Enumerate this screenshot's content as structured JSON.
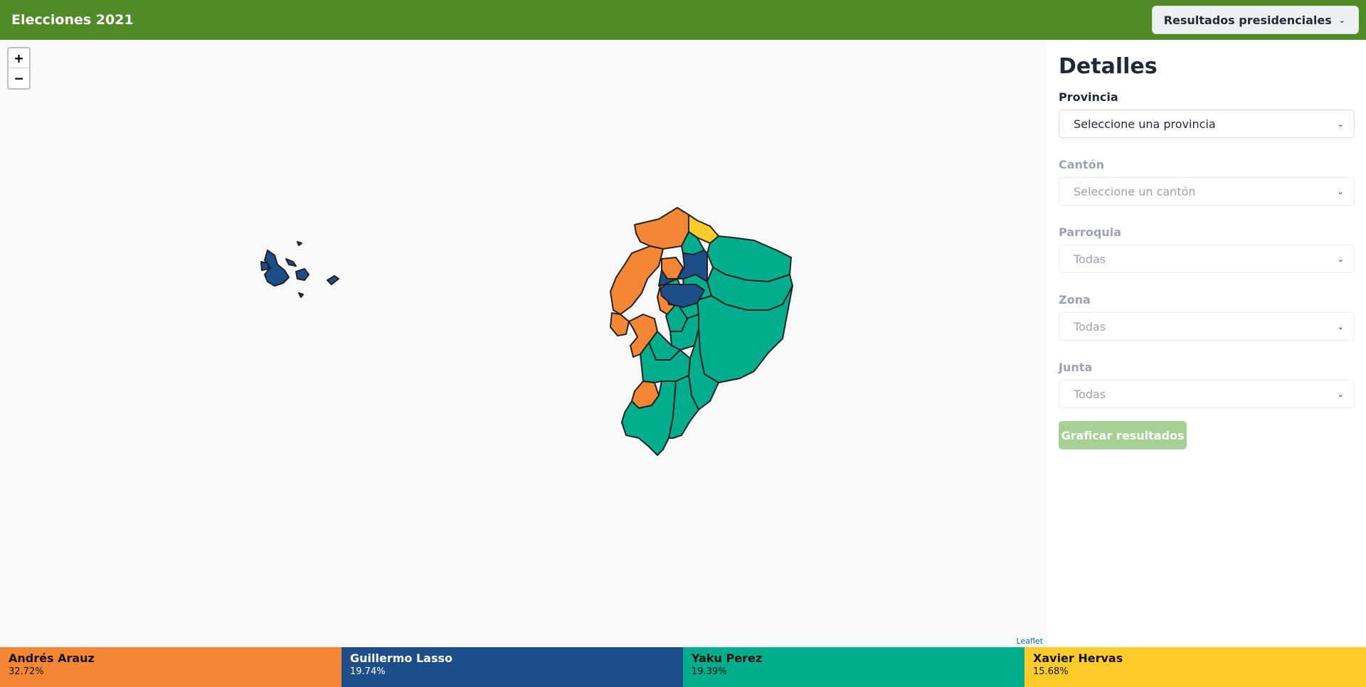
{
  "header": {
    "title": "Elecciones 2021",
    "results_button": "Resultados presidenciales"
  },
  "map": {
    "zoom_in": "+",
    "zoom_out": "−",
    "attribution": "Leaflet"
  },
  "panel": {
    "title": "Detalles",
    "fields": {
      "provincia": {
        "label": "Provincia",
        "value": "Seleccione una provincia"
      },
      "canton": {
        "label": "Cantón",
        "value": "Seleccione un cantón"
      },
      "parroquia": {
        "label": "Parroquia",
        "value": "Todas"
      },
      "zona": {
        "label": "Zona",
        "value": "Todas"
      },
      "junta": {
        "label": "Junta",
        "value": "Todas"
      }
    },
    "plot_button": "Graficar resultados"
  },
  "candidates": [
    {
      "name": "Andrés Arauz",
      "percent": "32.72%",
      "color": "#f58634"
    },
    {
      "name": "Guillermo Lasso",
      "percent": "19.74%",
      "color": "#1e4e89"
    },
    {
      "name": "Yaku Perez",
      "percent": "19.39%",
      "color": "#00ad8c"
    },
    {
      "name": "Xavier Hervas",
      "percent": "15.68%",
      "color": "#fdcb2a"
    }
  ],
  "colors": {
    "header": "#518b28",
    "arauz": "#f58634",
    "lasso": "#1e4e89",
    "perez": "#00ad8c",
    "hervas": "#fdcb2a"
  }
}
